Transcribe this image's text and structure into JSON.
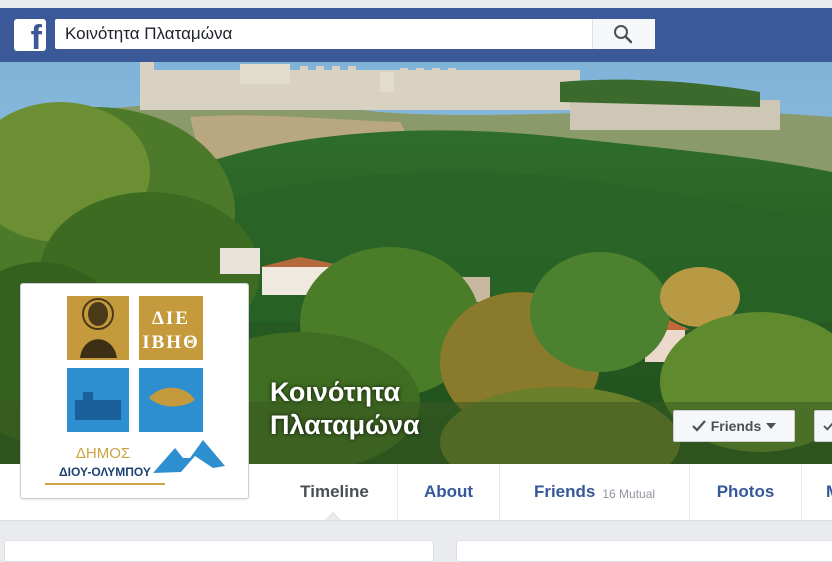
{
  "header": {
    "search_value": "Κοινότητα Πλαταμώνα",
    "search_icon": "magnifier"
  },
  "page": {
    "name_line1": "Κοινότητα",
    "name_line2": "Πλαταμώνα"
  },
  "actions": {
    "friends_label": "Friends"
  },
  "profile_logo": {
    "lettering": [
      "ΔΗΜΟΣ",
      "ΔΙΟΥ-ΟΛΥΜΠΟΥ"
    ],
    "tiles": [
      "ΔΙΕ ΙΒΗΘ"
    ]
  },
  "tabs": [
    {
      "label": "Timeline"
    },
    {
      "label": "About"
    },
    {
      "label": "Friends",
      "extra": "16 Mutual"
    },
    {
      "label": "Photos"
    },
    {
      "label": "M"
    }
  ],
  "colors": {
    "facebook_blue": "#3b5998",
    "link_blue": "#365899",
    "tab_active": "#4b4f56"
  }
}
